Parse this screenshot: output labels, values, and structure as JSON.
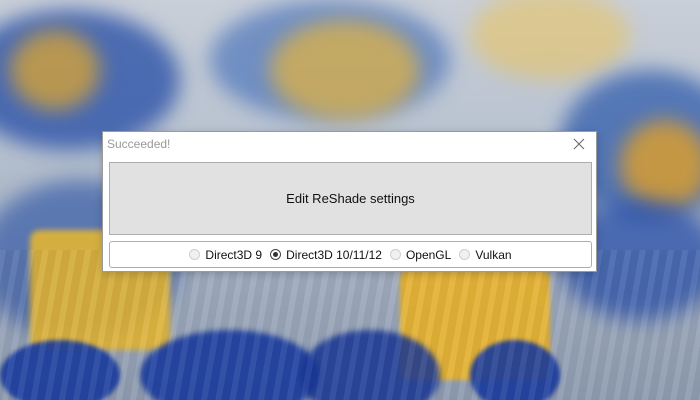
{
  "dialog": {
    "title": "Succeeded!",
    "close_icon": "close-icon",
    "main_button_label": "Edit ReShade settings",
    "api_options": [
      {
        "label": "Direct3D 9",
        "checked": false
      },
      {
        "label": "Direct3D 10/11/12",
        "checked": true
      },
      {
        "label": "OpenGL",
        "checked": false
      },
      {
        "label": "Vulkan",
        "checked": false
      }
    ]
  },
  "colors": {
    "title_text": "#9a9a9a",
    "button_bg": "#e1e1e1",
    "button_border": "#adadad",
    "wallpaper_blue": "#2a55b0",
    "wallpaper_yellow": "#e6b432"
  }
}
